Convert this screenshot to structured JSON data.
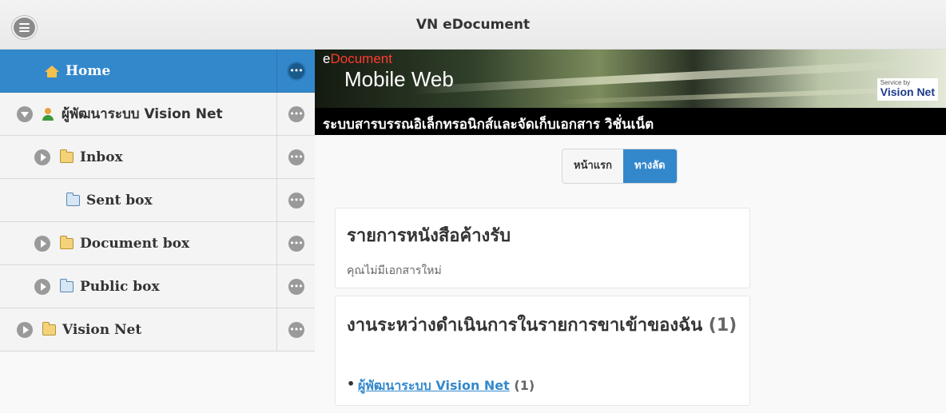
{
  "header": {
    "title": "VN eDocument"
  },
  "sidebar": {
    "items": [
      {
        "label": "Home"
      },
      {
        "label": "ผู้พัฒนาระบบ Vision Net"
      },
      {
        "label": "Inbox"
      },
      {
        "label": "Sent box"
      },
      {
        "label": "Document box"
      },
      {
        "label": "Public box"
      },
      {
        "label": "Vision Net"
      }
    ],
    "more_glyph": "•••"
  },
  "banner": {
    "e": "e",
    "document": "Document",
    "mobile_web": "Mobile Web",
    "service_by": "Service by",
    "vision_net": "Vision Net",
    "thai_subtitle": "ระบบสารบรรณอิเล็กทรอนิกส์และจัดเก็บเอกสาร วิชั่นเน็ต"
  },
  "tabs": [
    {
      "label": "หน้าแรก",
      "selected": false
    },
    {
      "label": "ทางลัด",
      "selected": true
    }
  ],
  "pending": {
    "title": "รายการหนังสือค้างรับ",
    "message": "คุณไม่มีเอกสารใหม่"
  },
  "in_progress": {
    "title": "งานระหว่างดำเนินการในรายการขาเข้าของฉัน",
    "count": "(1)",
    "items": [
      {
        "link": "ผู้พัฒนาระบบ Vision Net",
        "count": "(1)"
      }
    ]
  },
  "colors": {
    "accent": "#3388cc",
    "active_row": "#3388cc",
    "brand_red": "#ff3b2f"
  },
  "icons": [
    "menu-icon",
    "home-icon",
    "user-icon",
    "inbox-folder-icon",
    "sent-folder-icon",
    "document-folder-icon",
    "public-folder-icon",
    "visionnet-folder-icon",
    "more-icon",
    "expand-arrow-icon",
    "collapse-arrow-icon"
  ]
}
